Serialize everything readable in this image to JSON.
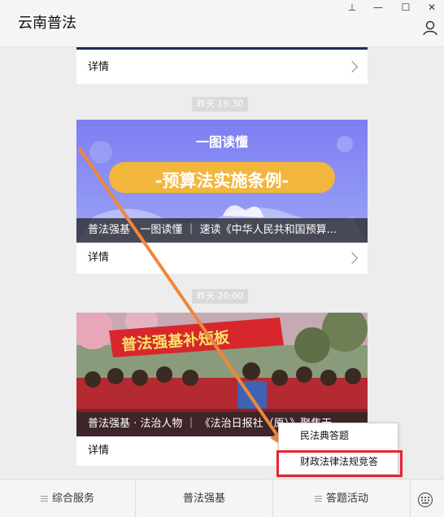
{
  "titlebar": {
    "app_title": "云南普法",
    "pin_glyph": "⊥",
    "minimize_glyph": "—",
    "maximize_glyph": "☐",
    "close_glyph": "✕"
  },
  "cards": [
    {
      "detail": "详情"
    },
    {
      "timestamp": "昨天 19:30",
      "banner_heading": "一图读懂",
      "banner_title": "-预算法实施条例-",
      "caption": "普法强基 · 一图读懂 ｜ 速读《中华人民共和国预算...",
      "detail": "详情"
    },
    {
      "timestamp": "昨天 20:00",
      "banner_text": "普法强基补短板",
      "caption": "普法强基 · 法治人物 ｜ 《法治日报社（原）》聚焦天...",
      "detail": "详情"
    }
  ],
  "bottom_nav": {
    "items": [
      "综合服务",
      "普法强基",
      "答题活动"
    ]
  },
  "popup_menu": {
    "items": [
      "民法典答题",
      "财政法律法规竞答"
    ]
  },
  "colors": {
    "highlight_border": "#e8262f",
    "annotation_arrow": "#f0873a",
    "banner_gradient_top": "#7d7ef2",
    "banner_pill": "#f3b63c"
  }
}
